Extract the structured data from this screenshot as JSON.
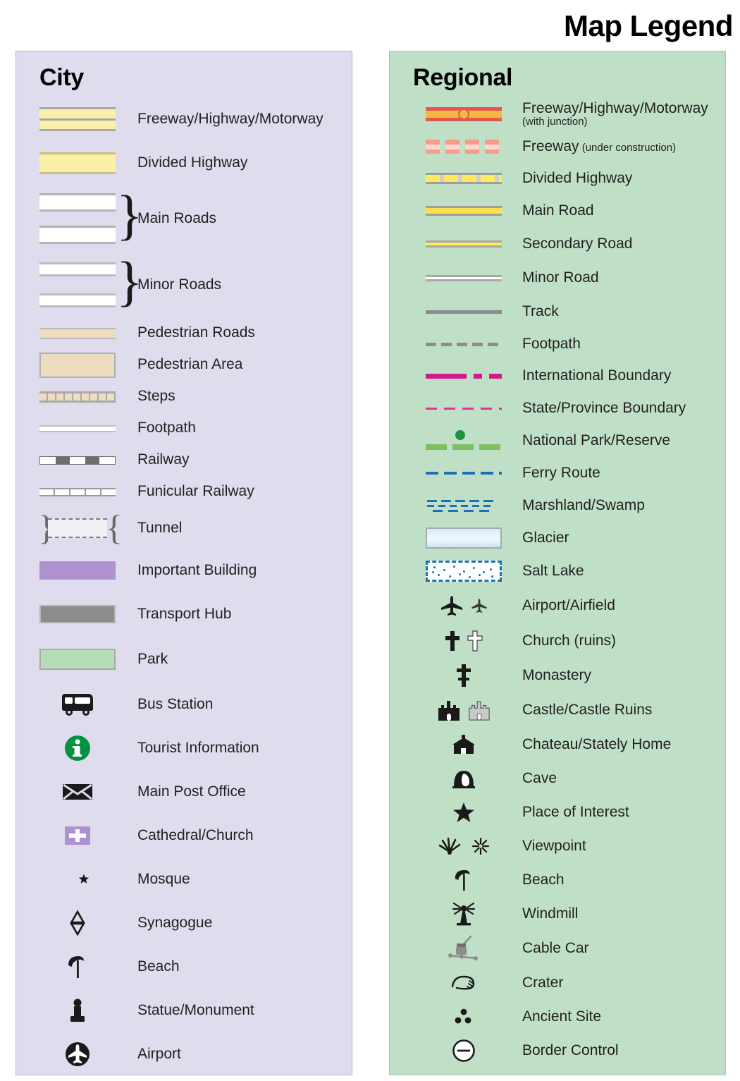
{
  "title": "Map Legend",
  "city": {
    "heading": "City",
    "bg_color": "#dedced",
    "items": [
      {
        "label": "Freeway/Highway/Motorway",
        "symbol": "city-freeway"
      },
      {
        "label": "Divided Highway",
        "symbol": "city-divided-highway"
      },
      {
        "label": "Main Roads",
        "symbol": "city-main-roads"
      },
      {
        "label": "Minor Roads",
        "symbol": "city-minor-roads"
      },
      {
        "label": "Pedestrian Roads",
        "symbol": "city-pedestrian-road"
      },
      {
        "label": "Pedestrian Area",
        "symbol": "city-pedestrian-area"
      },
      {
        "label": "Steps",
        "symbol": "city-steps"
      },
      {
        "label": "Footpath",
        "symbol": "city-footpath"
      },
      {
        "label": "Railway",
        "symbol": "city-railway"
      },
      {
        "label": "Funicular Railway",
        "symbol": "city-funicular-railway"
      },
      {
        "label": "Tunnel",
        "symbol": "city-tunnel"
      },
      {
        "label": "Important Building",
        "symbol": "city-important-building"
      },
      {
        "label": "Transport Hub",
        "symbol": "city-transport-hub"
      },
      {
        "label": "Park",
        "symbol": "city-park"
      },
      {
        "label": "Bus Station",
        "symbol": "bus-icon"
      },
      {
        "label": "Tourist Information",
        "symbol": "information-icon"
      },
      {
        "label": "Main Post Office",
        "symbol": "envelope-icon"
      },
      {
        "label": "Cathedral/Church",
        "symbol": "cathedral-icon"
      },
      {
        "label": "Mosque",
        "symbol": "mosque-icon"
      },
      {
        "label": "Synagogue",
        "symbol": "synagogue-icon"
      },
      {
        "label": "Beach",
        "symbol": "beach-icon"
      },
      {
        "label": "Statue/Monument",
        "symbol": "statue-icon"
      },
      {
        "label": "Airport",
        "symbol": "airport-circle-icon"
      }
    ]
  },
  "regional": {
    "heading": "Regional",
    "bg_color": "#bfe0c6",
    "items": [
      {
        "label": "Freeway/Highway/Motorway",
        "sublabel": "(with junction)",
        "symbol": "regional-freeway-junction"
      },
      {
        "label": "Freeway",
        "inline_sublabel": " (under construction)",
        "symbol": "regional-freeway-construction"
      },
      {
        "label": "Divided Highway",
        "symbol": "regional-divided-highway"
      },
      {
        "label": "Main Road",
        "symbol": "regional-main-road"
      },
      {
        "label": "Secondary Road",
        "symbol": "regional-secondary-road"
      },
      {
        "label": "Minor Road",
        "symbol": "regional-minor-road"
      },
      {
        "label": "Track",
        "symbol": "regional-track"
      },
      {
        "label": "Footpath",
        "symbol": "regional-footpath"
      },
      {
        "label": "International Boundary",
        "symbol": "regional-international-boundary"
      },
      {
        "label": "State/Province Boundary",
        "symbol": "regional-state-boundary"
      },
      {
        "label": "National Park/Reserve",
        "symbol": "regional-national-park"
      },
      {
        "label": "Ferry Route",
        "symbol": "regional-ferry-route"
      },
      {
        "label": "Marshland/Swamp",
        "symbol": "regional-marshland"
      },
      {
        "label": "Glacier",
        "symbol": "regional-glacier"
      },
      {
        "label": "Salt Lake",
        "symbol": "regional-salt-lake"
      },
      {
        "label": "Airport/Airfield",
        "symbol": "airplane-pair-icon"
      },
      {
        "label": "Church (ruins)",
        "symbol": "cross-pair-icon"
      },
      {
        "label": "Monastery",
        "symbol": "monastery-cross-icon"
      },
      {
        "label": "Castle/Castle Ruins",
        "symbol": "castle-pair-icon"
      },
      {
        "label": "Chateau/Stately Home",
        "symbol": "chateau-icon"
      },
      {
        "label": "Cave",
        "symbol": "cave-icon"
      },
      {
        "label": "Place of Interest",
        "symbol": "star-icon"
      },
      {
        "label": "Viewpoint",
        "symbol": "viewpoint-pair-icon"
      },
      {
        "label": "Beach",
        "symbol": "beach-icon"
      },
      {
        "label": "Windmill",
        "symbol": "windmill-icon"
      },
      {
        "label": "Cable Car",
        "symbol": "cable-car-icon"
      },
      {
        "label": "Crater",
        "symbol": "crater-icon"
      },
      {
        "label": "Ancient Site",
        "symbol": "ancient-site-icon"
      },
      {
        "label": "Border Control",
        "symbol": "border-control-icon"
      }
    ]
  },
  "colors": {
    "city_panel": "#dedced",
    "regional_panel": "#bfe0c6",
    "freeway_yellow": "#fbf0a8",
    "freeway_red": "#e0584e",
    "junction_orange": "#f5b841",
    "boundary_magenta": "#d31b8a",
    "park_green": "#7dbf63",
    "ferry_blue": "#1f6fb8",
    "info_green": "#00923f",
    "building_purple": "#ad92cf",
    "pedestrian_tan": "#ecdcc0"
  }
}
